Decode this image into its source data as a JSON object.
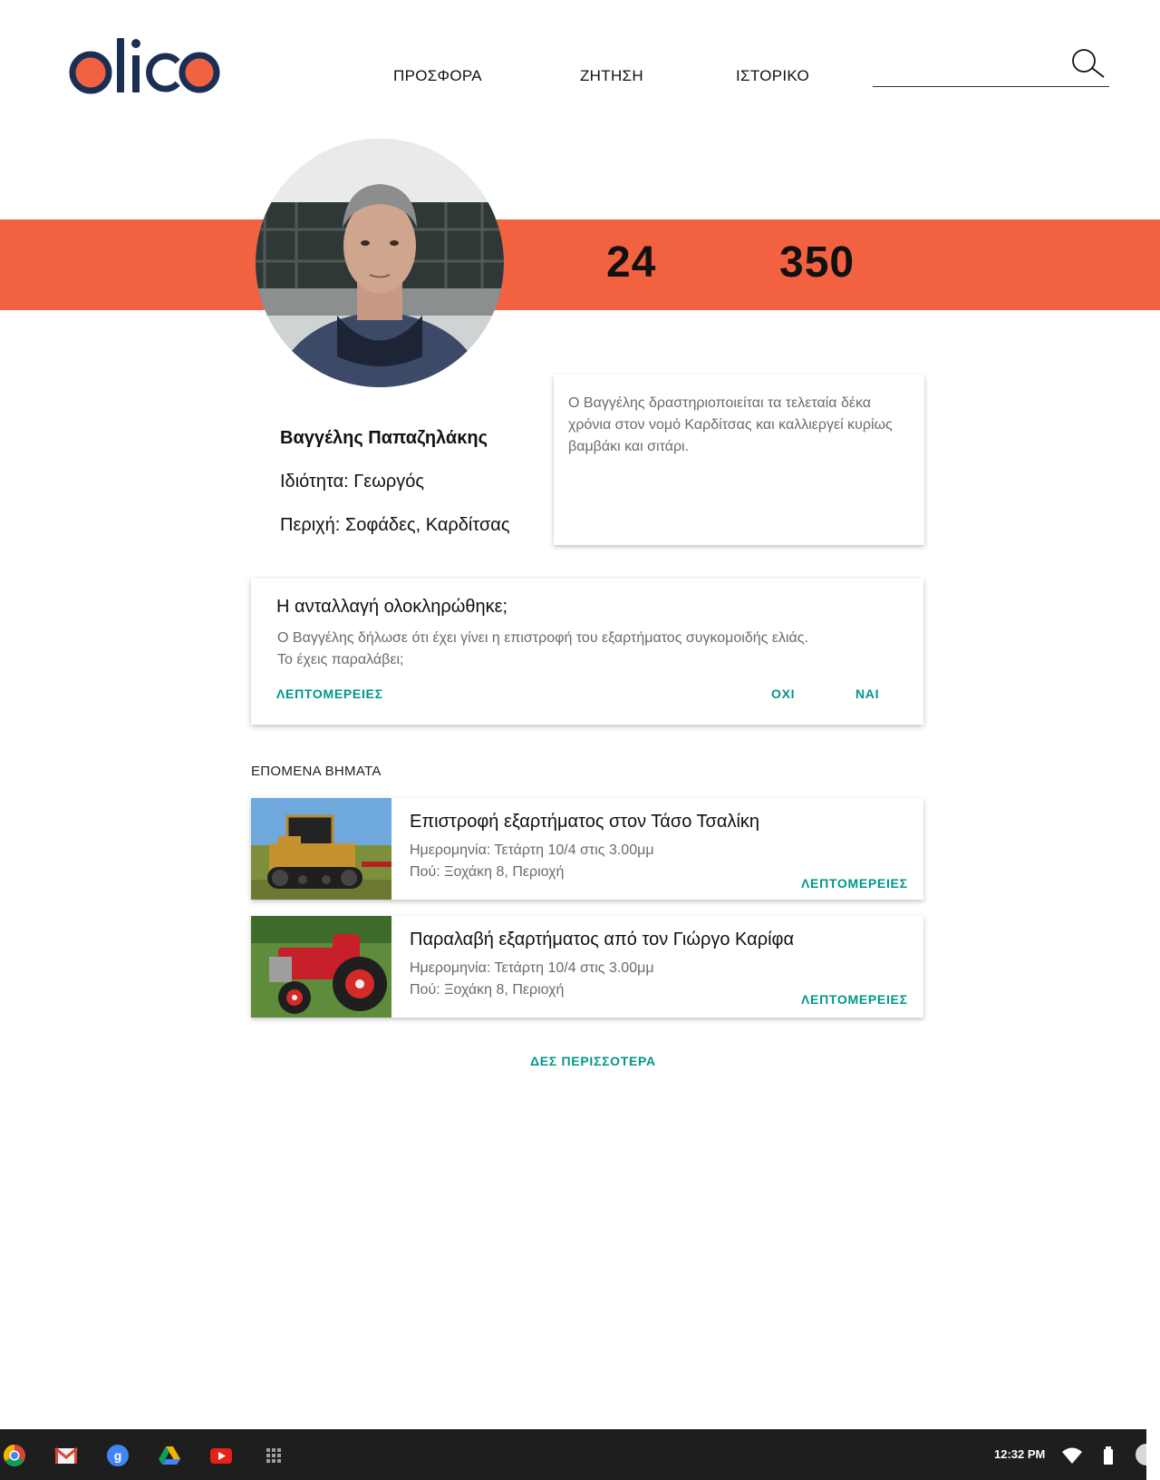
{
  "header": {
    "logo_text": "olico",
    "nav": [
      {
        "label": "ΠΡΟΣΦΟΡΑ"
      },
      {
        "label": "ΖΗΤΗΣΗ"
      },
      {
        "label": "ΙΣΤΟΡΙΚΟ"
      }
    ],
    "search": {
      "value": "",
      "placeholder": ""
    }
  },
  "colors": {
    "accent": "#f26241",
    "brand_dark": "#1b2f55",
    "teal": "#00968a"
  },
  "profile": {
    "stats": [
      "24",
      "350"
    ],
    "name": "Βαγγέλης Παπαζηλάκης",
    "occupation": "Ιδιότητα: Γεωργός",
    "area": "Περιχή: Σοφάδες, Καρδίτσας",
    "bio": "Ο Βαγγέλης δραστηριοποιείται τα τελεταία δέκα χρόνια στον νομό Καρδίτσας και καλλιεργεί κυρίως βαμβάκι και σιτάρι."
  },
  "exchange": {
    "title": "Η ανταλλαγή ολοκληρώθηκε;",
    "line1": "Ο Βαγγέλης δήλωσε ότι έχει γίνει η επιστροφή του εξαρτήματος συγκομοιδής ελιάς.",
    "line2": "Το έχεις παραλάβει;",
    "details_label": "ΛΕΠΤΟΜΕΡΕΙΕΣ",
    "no_label": "ΟΧΙ",
    "yes_label": "ΝΑΙ"
  },
  "next_steps": {
    "label": "ΕΠΟΜΕΝΑ ΒΗΜΑΤΑ",
    "items": [
      {
        "title": "Επιστροφή εξαρτήματος στον Τάσο Τσαλίκη",
        "date": "Ημερομηνία: Τετάρτη 10/4 στις 3.00μμ",
        "place": "Πού: Ξοχάκη 8, Περιοχή",
        "details_label": "ΛΕΠΤΟΜΕΡΕΙΕΣ",
        "image": "yellow-tracked-tractor"
      },
      {
        "title": "Παραλαβή εξαρτήματος από τον Γιώργο Καρίφα",
        "date": "Ημερομηνία: Τετάρτη 10/4 στις 3.00μμ",
        "place": "Πού: Ξοχάκη 8, Περιοχή",
        "details_label": "ΛΕΠΤΟΜΕΡΕΙΕΣ",
        "image": "red-vintage-tractor"
      }
    ],
    "more_label": "ΔΕΣ ΠΕΡΙΣΣΟΤΕΡΑ"
  },
  "taskbar": {
    "apps": [
      "chrome-icon",
      "gmail-icon",
      "google-search-icon",
      "drive-icon",
      "youtube-icon",
      "app-launcher-icon"
    ],
    "time": "12:32 PM"
  }
}
